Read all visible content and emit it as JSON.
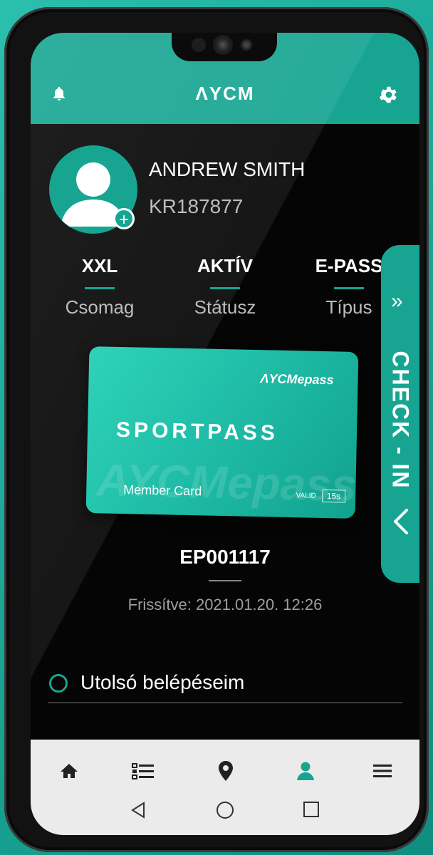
{
  "header": {
    "title": "ΛYCM",
    "accent": "#17a592"
  },
  "profile": {
    "name": "ANDREW SMITH",
    "id": "KR187877"
  },
  "stats": [
    {
      "value": "XXL",
      "label": "Csomag"
    },
    {
      "value": "AKTÍV",
      "label": "Státusz"
    },
    {
      "value": "E-PASS",
      "label": "Típus"
    }
  ],
  "checkin": {
    "label": "CHECK - IN",
    "chevron": "»"
  },
  "card": {
    "brand": "ΛYCMepass",
    "title": "SPORTPASS",
    "member": "Member Card",
    "valid": "VALID",
    "valid_value": "15s",
    "watermark": "AYCMepass"
  },
  "pass": {
    "code": "EP001117",
    "updated": "Frissítve: 2021.01.20. 12:26"
  },
  "section": {
    "title": "Utolsó belépéseim"
  },
  "nav": {
    "items": [
      "home-icon",
      "list-icon",
      "location-pin-icon",
      "profile-icon",
      "menu-icon"
    ],
    "active": "profile-icon"
  },
  "system_nav": [
    "back-icon",
    "home-circle-icon",
    "recents-icon"
  ]
}
